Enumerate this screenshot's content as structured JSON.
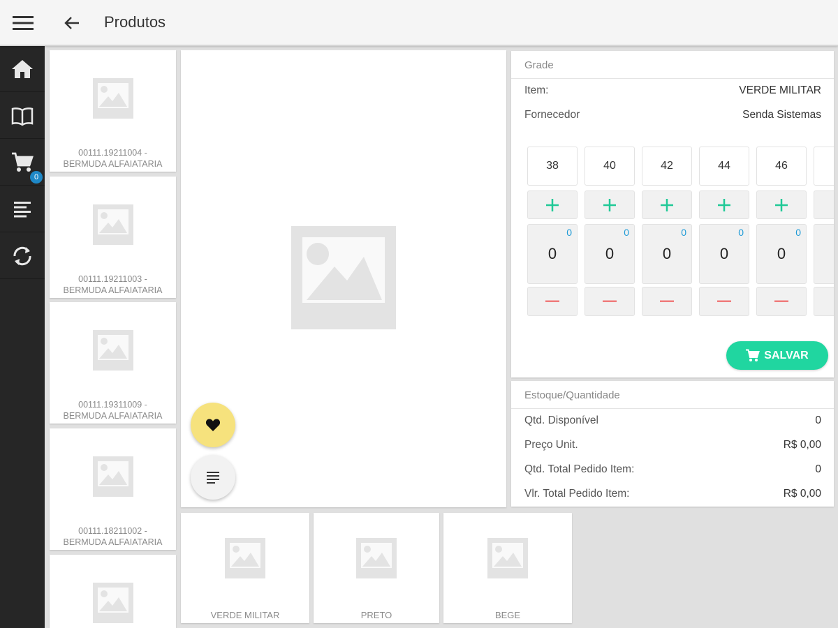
{
  "appbar": {
    "title": "Produtos",
    "menu_icon": "menu-icon",
    "back_icon": "arrow-back-icon"
  },
  "rail": {
    "items": [
      {
        "name": "home",
        "icon": "home-icon"
      },
      {
        "name": "catalog",
        "icon": "book-icon"
      },
      {
        "name": "cart",
        "icon": "cart-icon",
        "badge": "0"
      },
      {
        "name": "orders",
        "icon": "list-icon"
      },
      {
        "name": "sync",
        "icon": "sync-icon"
      }
    ]
  },
  "products": [
    {
      "code": "00111.19211004 -",
      "name": "BERMUDA ALFAIATARIA"
    },
    {
      "code": "00111.19211003 -",
      "name": "BERMUDA ALFAIATARIA"
    },
    {
      "code": "00111.19311009 -",
      "name": "BERMUDA ALFAIATARIA"
    },
    {
      "code": "00111.18211002 -",
      "name": "BERMUDA ALFAIATARIA"
    },
    {
      "code": "",
      "name": ""
    }
  ],
  "colors": [
    "VERDE MILITAR",
    "PRETO",
    "BEGE"
  ],
  "grade": {
    "title": "Grade",
    "item_label": "Item:",
    "item_value": "VERDE MILITAR",
    "supplier_label": "Fornecedor",
    "supplier_value": "Senda Sistemas",
    "sizes": [
      {
        "size": "38",
        "qty": "0",
        "stock": "0"
      },
      {
        "size": "40",
        "qty": "0",
        "stock": "0"
      },
      {
        "size": "42",
        "qty": "0",
        "stock": "0"
      },
      {
        "size": "44",
        "qty": "0",
        "stock": "0"
      },
      {
        "size": "46",
        "qty": "0",
        "stock": "0"
      }
    ],
    "save_label": "SALVAR",
    "accent_color": "#20d6a0"
  },
  "stock": {
    "title": "Estoque/Quantidade",
    "rows": [
      {
        "label": "Qtd. Disponível",
        "value": "0"
      },
      {
        "label": "Preço Unit.",
        "value": "R$ 0,00"
      },
      {
        "label": "Qtd. Total Pedido Item:",
        "value": "0"
      },
      {
        "label": "Vlr. Total Pedido Item:",
        "value": "R$ 0,00"
      }
    ]
  }
}
